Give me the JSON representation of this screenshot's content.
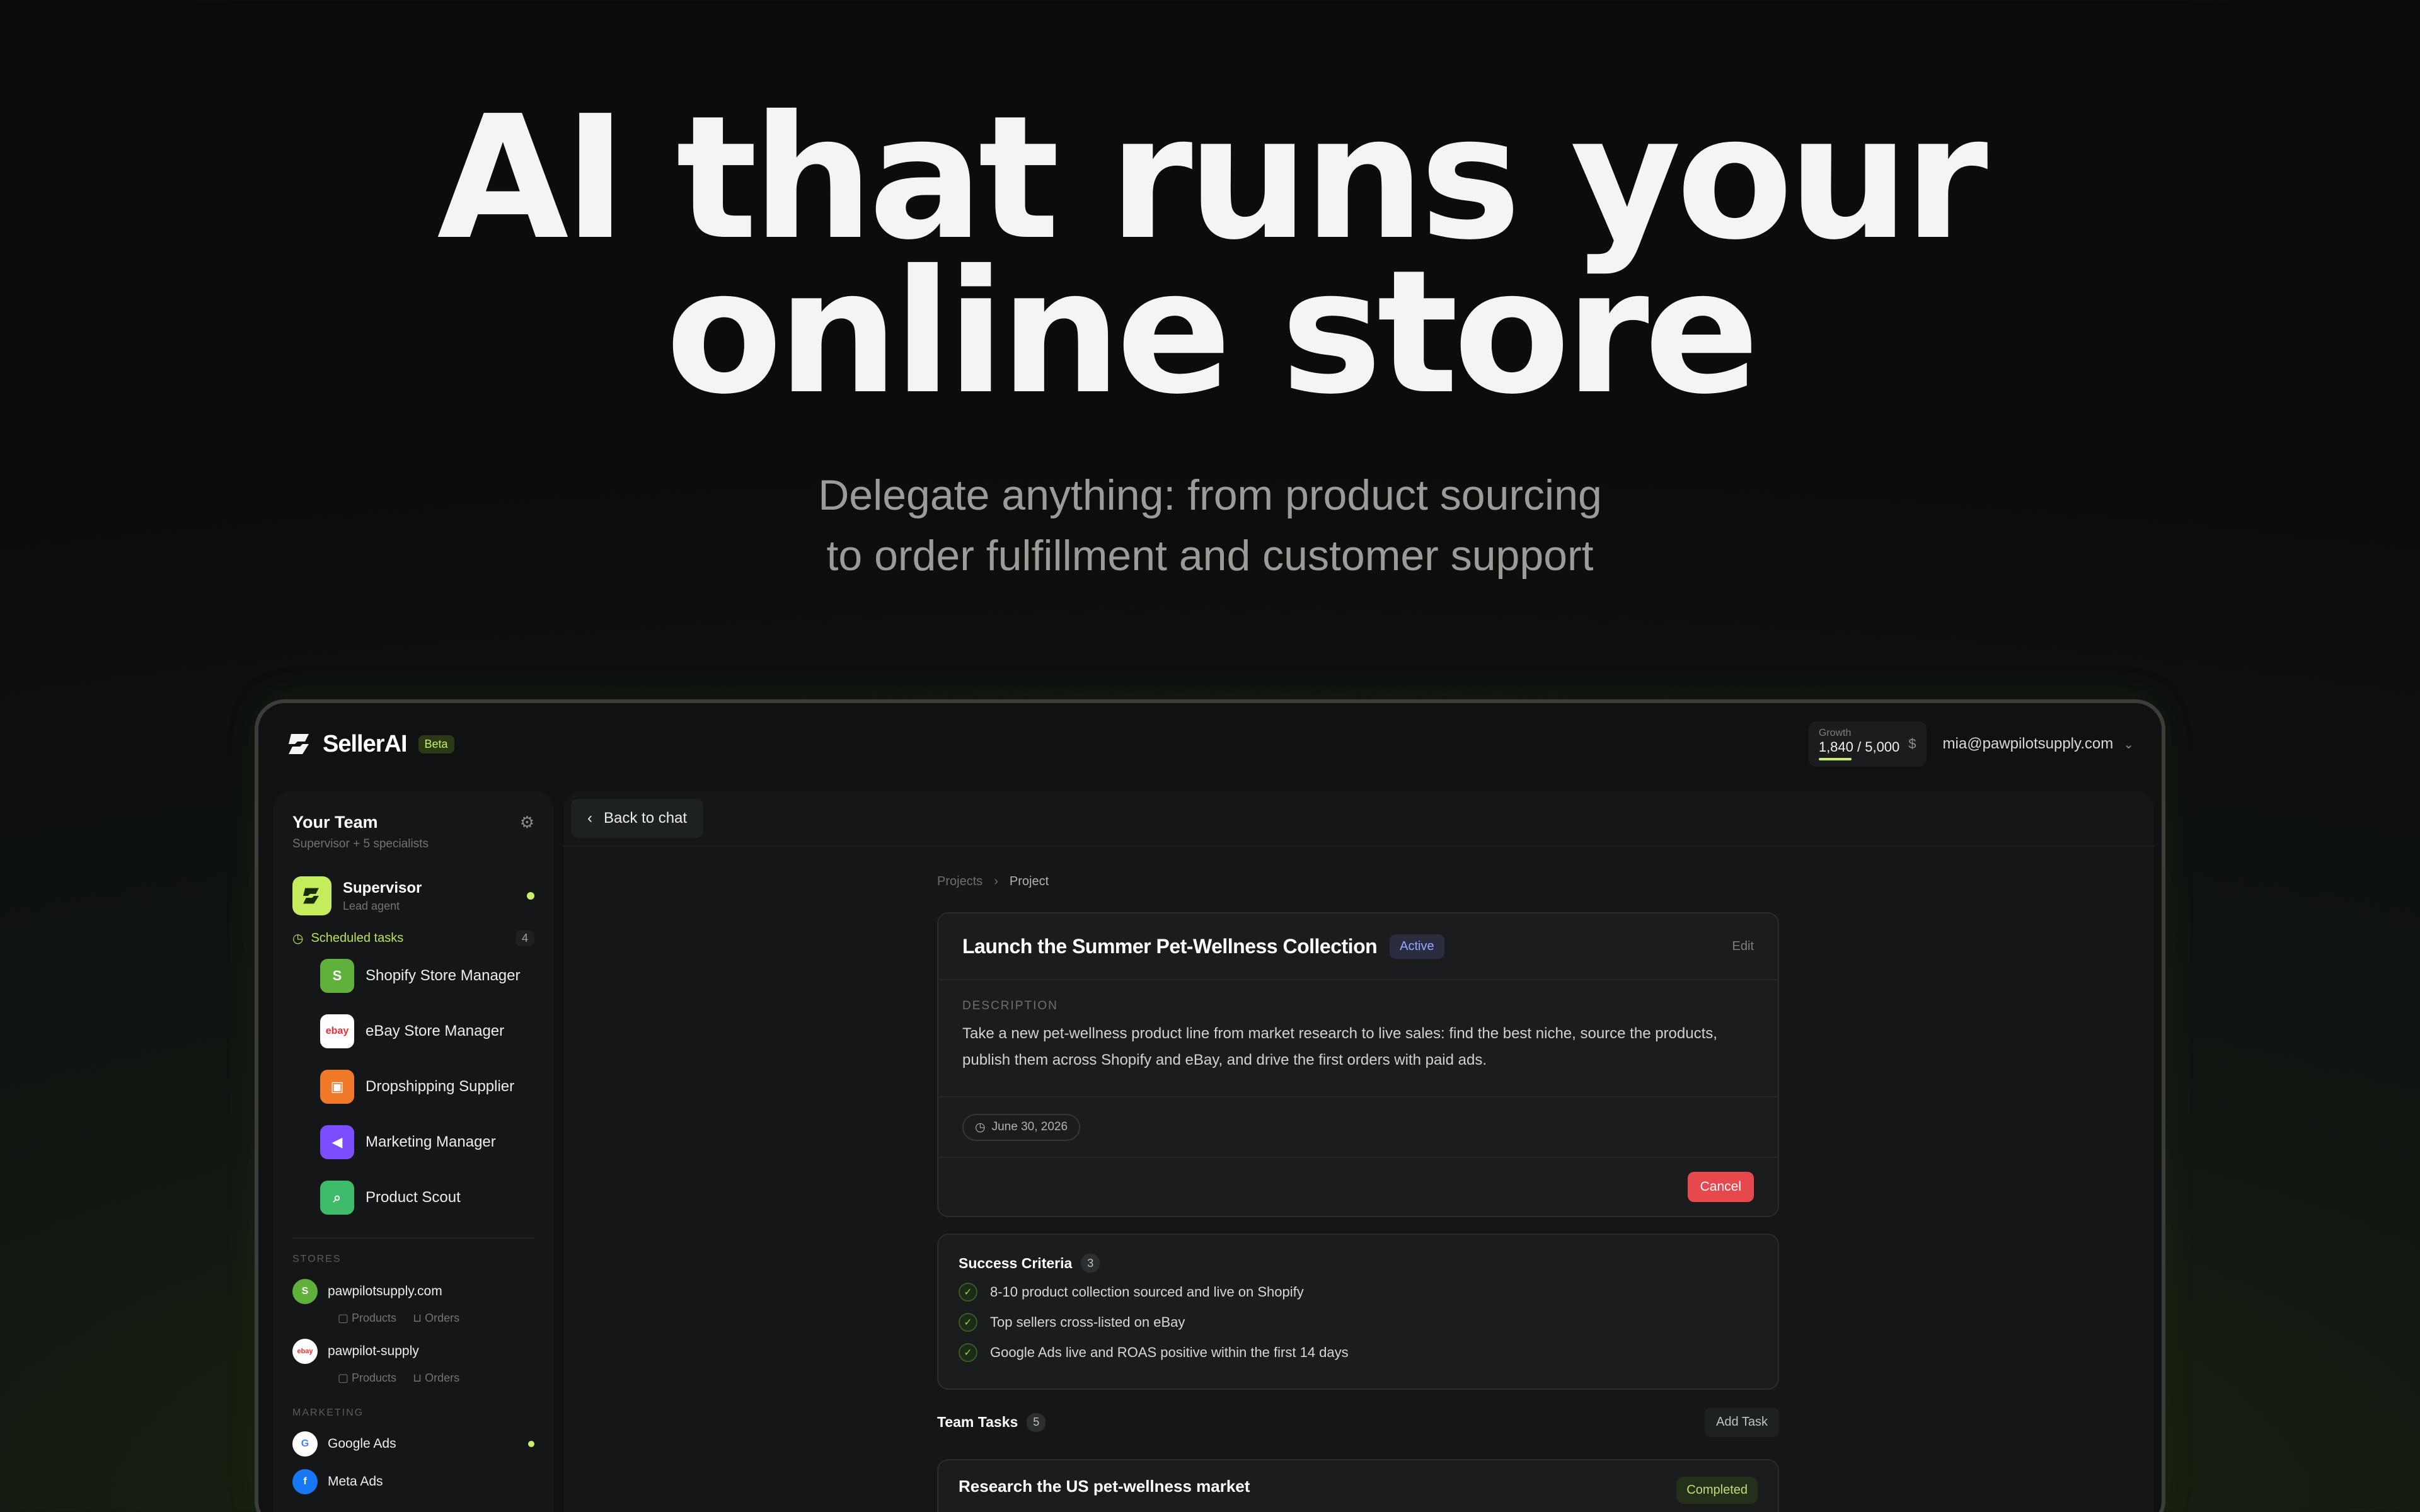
{
  "hero": {
    "title_line1": "AI that runs your",
    "title_line2": "online store",
    "subtitle_line1": "Delegate anything: from product sourcing",
    "subtitle_line2": "to order fulfillment and customer support"
  },
  "app": {
    "brand": "SellerAI",
    "badge": "Beta",
    "growth": {
      "label": "Growth",
      "value": "1,840 / 5,000",
      "currency_icon": "$",
      "progress": 0.368
    },
    "user_email": "mia@pawpilotsupply.com"
  },
  "sidebar": {
    "title": "Your Team",
    "subtitle": "Supervisor + 5 specialists",
    "supervisor": {
      "name": "Supervisor",
      "role": "Lead agent"
    },
    "scheduled": {
      "label": "Scheduled tasks",
      "count": "4"
    },
    "specialists": [
      {
        "name": "Shopify Store Manager",
        "color": "#5fb13c",
        "icon": "shopify-icon"
      },
      {
        "name": "eBay Store Manager",
        "color": "#ffffff",
        "icon": "ebay-icon"
      },
      {
        "name": "Dropshipping Supplier",
        "color": "#f07a2a",
        "icon": "box-icon"
      },
      {
        "name": "Marketing Manager",
        "color": "#7c4dff",
        "icon": "megaphone-icon"
      },
      {
        "name": "Product Scout",
        "color": "#3dbb6a",
        "icon": "search-icon"
      }
    ],
    "stores_label": "STORES",
    "stores": [
      {
        "name": "pawpilotsupply.com",
        "products": "Products",
        "orders": "Orders"
      },
      {
        "name": "pawpilot-supply",
        "products": "Products",
        "orders": "Orders"
      }
    ],
    "marketing_label": "MARKETING",
    "marketing": [
      {
        "name": "Google Ads"
      },
      {
        "name": "Meta Ads"
      }
    ]
  },
  "main": {
    "back_label": "Back to chat",
    "breadcrumb": {
      "root": "Projects",
      "current": "Project"
    },
    "project": {
      "title": "Launch the Summer Pet-Wellness Collection",
      "status": "Active",
      "edit": "Edit",
      "description_label": "DESCRIPTION",
      "description": "Take a new pet-wellness product line from market research to live sales: find the best niche, source the products, publish them across Shopify and eBay, and drive the first orders with paid ads.",
      "date": "June 30, 2026",
      "cancel": "Cancel"
    },
    "criteria": {
      "title": "Success Criteria",
      "count": "3",
      "items": [
        "8-10 product collection sourced and live on Shopify",
        "Top sellers cross-listed on eBay",
        "Google Ads live and ROAS positive within the first 14 days"
      ]
    },
    "tasks": {
      "title": "Team Tasks",
      "count": "5",
      "add_label": "Add Task",
      "items": [
        {
          "title": "Research the US pet-wellness market",
          "status": "Completed"
        }
      ]
    }
  }
}
